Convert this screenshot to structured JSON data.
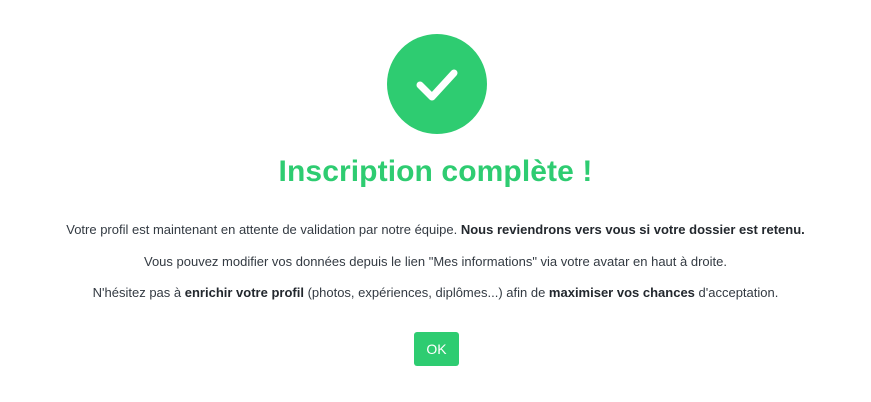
{
  "dialog": {
    "icon": "check-circle-icon",
    "title": "Inscription complète !",
    "line1": {
      "part1": "Votre profil est maintenant en attente de validation par notre équipe. ",
      "bold1": "Nous reviendrons vers vous si votre dossier est retenu."
    },
    "line2": {
      "text": "Vous pouvez modifier vos données depuis le lien \"Mes informations\" via votre avatar en haut à droite."
    },
    "line3": {
      "part1": "N'hésitez pas à ",
      "bold1": "enrichir votre profil",
      "part2": " (photos, expériences, diplômes...) afin de ",
      "bold2": "maximiser vos chances",
      "part3": " d'acceptation."
    },
    "ok_label": "OK"
  },
  "colors": {
    "accent": "#2ecc71",
    "text": "#333a42",
    "background": "#ffffff"
  }
}
